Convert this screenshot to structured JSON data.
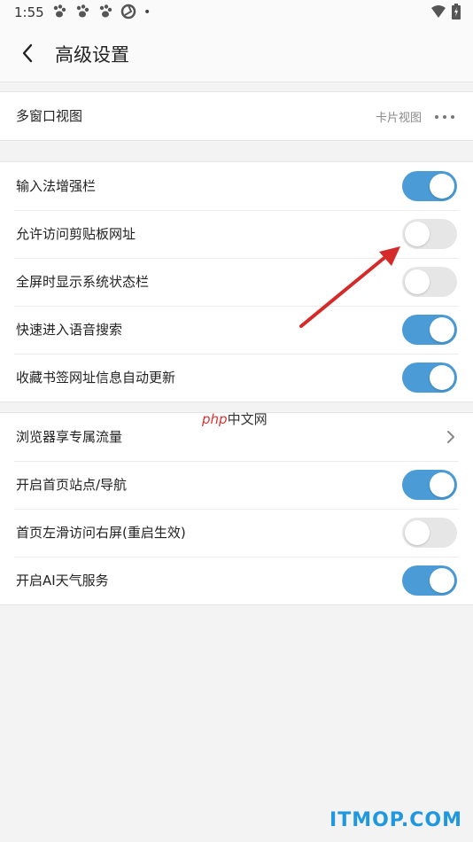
{
  "status": {
    "time": "1:55",
    "dot": "•"
  },
  "header": {
    "title": "高级设置"
  },
  "groups": [
    {
      "rows": [
        {
          "label": "多窗口视图",
          "value": "卡片视图"
        }
      ]
    },
    {
      "rows": [
        {
          "label": "输入法增强栏",
          "toggle": "on"
        },
        {
          "label": "允许访问剪贴板网址",
          "toggle": "off"
        },
        {
          "label": "全屏时显示系统状态栏",
          "toggle": "off"
        },
        {
          "label": "快速进入语音搜索",
          "toggle": "on"
        },
        {
          "label": "收藏书签网址信息自动更新",
          "toggle": "on"
        }
      ]
    },
    {
      "rows": [
        {
          "label": "浏览器享专属流量"
        },
        {
          "label": "开启首页站点/导航",
          "toggle": "on"
        },
        {
          "label": "首页左滑访问右屏(重启生效)",
          "toggle": "off"
        },
        {
          "label": "开启AI天气服务",
          "toggle": "on"
        }
      ]
    }
  ],
  "watermarks": {
    "php": "php",
    "cn": "中文网",
    "site": "ITMOP.COM"
  },
  "colors": {
    "toggle_on": "#4a9bd6",
    "toggle_off": "#e6e6e6",
    "arrow": "#d42a2a"
  }
}
